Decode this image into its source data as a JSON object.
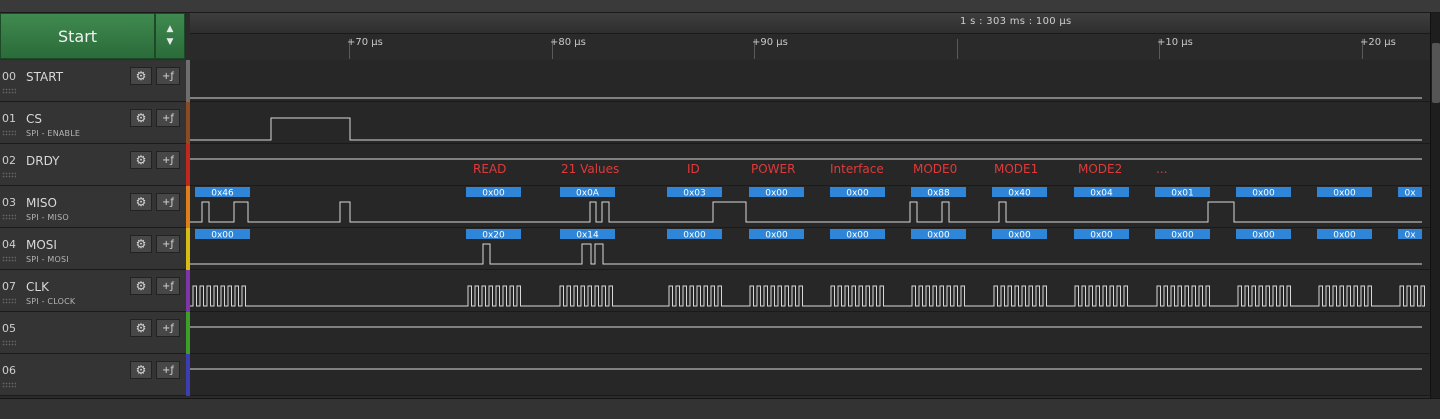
{
  "capture": {
    "start_label": "Start",
    "up_arrow": "▲",
    "down_arrow": "▼",
    "absolute_time": "1 s : 303 ms : 100 µs"
  },
  "ruler_ticks": [
    "+70 µs",
    "+80 µs",
    "+90 µs",
    "+10 µs",
    "+20 µs"
  ],
  "channels": [
    {
      "num": "00",
      "name": "START",
      "analyzer": "",
      "color": "#6e6e6e"
    },
    {
      "num": "01",
      "name": "CS",
      "analyzer": "SPI - ENABLE",
      "color": "#8a4a22"
    },
    {
      "num": "02",
      "name": "DRDY",
      "analyzer": "",
      "color": "#c0271f"
    },
    {
      "num": "03",
      "name": "MISO",
      "analyzer": "SPI - MISO",
      "color": "#e07d1c"
    },
    {
      "num": "04",
      "name": "MOSI",
      "analyzer": "SPI - MOSI",
      "color": "#d9bb15"
    },
    {
      "num": "07",
      "name": "CLK",
      "analyzer": "SPI - CLOCK",
      "color": "#7d35a8"
    },
    {
      "num": "05",
      "name": "",
      "analyzer": "",
      "color": "#3d9e2a"
    },
    {
      "num": "06",
      "name": "",
      "analyzer": "",
      "color": "#3b3db0"
    }
  ],
  "buttons": {
    "gear_icon": "⚙",
    "add_analyzer_icon": "+ƒ"
  },
  "annotations": [
    "READ",
    "21 Values",
    "ID",
    "POWER",
    "Interface",
    "MODE0",
    "MODE1",
    "MODE2",
    "..."
  ],
  "miso_bytes": [
    "0x46",
    "0x00",
    "0x0A",
    "0x03",
    "0x00",
    "0x00",
    "0x88",
    "0x40",
    "0x04",
    "0x01",
    "0x00",
    "0x00",
    "0x"
  ],
  "mosi_bytes": [
    "0x00",
    "0x20",
    "0x14",
    "0x00",
    "0x00",
    "0x00",
    "0x00",
    "0x00",
    "0x00",
    "0x00",
    "0x00",
    "0x00",
    "0x"
  ],
  "colors": {
    "background": "#272727",
    "trace": "#d8d8d8",
    "byte_box": "#2f86d8",
    "annotation": "#e03a3a",
    "start_green": "#3f8a4f"
  }
}
